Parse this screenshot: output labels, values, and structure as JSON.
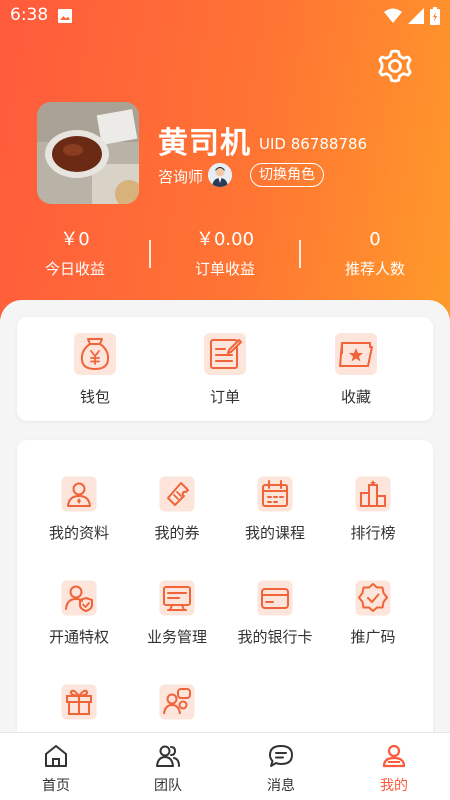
{
  "status_bar": {
    "time": "6:38"
  },
  "profile": {
    "name": "黄司机",
    "uid": "UID 86788786",
    "role": "咨询师",
    "switch_role_label": "切换角色"
  },
  "stats": [
    {
      "value": "￥0",
      "label": "今日收益"
    },
    {
      "value": "￥0.00",
      "label": "订单收益"
    },
    {
      "value": "0",
      "label": "推荐人数"
    }
  ],
  "quick_actions": [
    {
      "label": "钱包",
      "icon": "wallet-icon"
    },
    {
      "label": "订单",
      "icon": "order-icon"
    },
    {
      "label": "收藏",
      "icon": "favorite-icon"
    }
  ],
  "menu_items": [
    {
      "label": "我的资料",
      "icon": "profile-icon"
    },
    {
      "label": "我的券",
      "icon": "coupon-icon"
    },
    {
      "label": "我的课程",
      "icon": "course-icon"
    },
    {
      "label": "排行榜",
      "icon": "ranking-icon"
    },
    {
      "label": "开通特权",
      "icon": "privilege-icon"
    },
    {
      "label": "业务管理",
      "icon": "business-icon"
    },
    {
      "label": "我的银行卡",
      "icon": "bank-card-icon"
    },
    {
      "label": "推广码",
      "icon": "promo-code-icon"
    },
    {
      "label": "",
      "icon": "gift-icon"
    },
    {
      "label": "",
      "icon": "team-chat-icon"
    }
  ],
  "bottom_nav": [
    {
      "label": "首页",
      "icon": "home-icon"
    },
    {
      "label": "团队",
      "icon": "team-icon"
    },
    {
      "label": "消息",
      "icon": "message-icon"
    },
    {
      "label": "我的",
      "icon": "me-icon",
      "active": true
    }
  ],
  "colors": {
    "accent": "#ff5a3c",
    "gradient_end": "#ff9a2a",
    "icon_bg": "#fde5dc",
    "icon_stroke": "#f0643a"
  }
}
